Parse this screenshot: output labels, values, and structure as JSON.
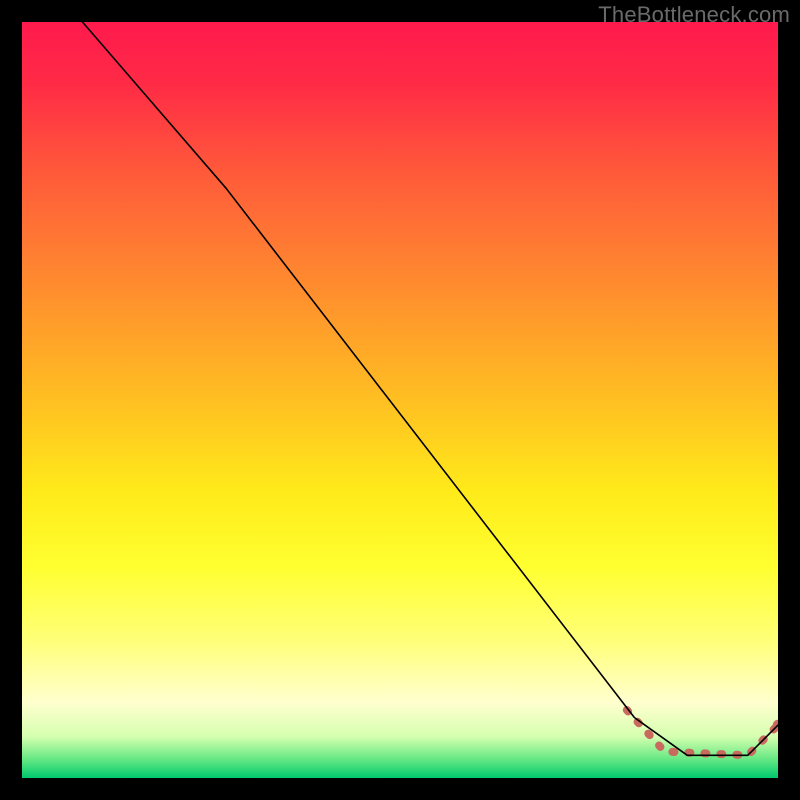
{
  "watermark": "TheBottleneck.com",
  "colors": {
    "background": "#000000",
    "line_solid": "#000000",
    "line_dashed": "#c96a5e",
    "watermark_text": "#6a6a6a",
    "gradient_stops": [
      {
        "offset": 0.0,
        "color": "#ff1a4d"
      },
      {
        "offset": 0.08,
        "color": "#ff2a46"
      },
      {
        "offset": 0.2,
        "color": "#ff5a3a"
      },
      {
        "offset": 0.35,
        "color": "#ff8c2e"
      },
      {
        "offset": 0.5,
        "color": "#ffbf22"
      },
      {
        "offset": 0.62,
        "color": "#ffea1a"
      },
      {
        "offset": 0.72,
        "color": "#ffff30"
      },
      {
        "offset": 0.82,
        "color": "#ffff7a"
      },
      {
        "offset": 0.9,
        "color": "#ffffcf"
      },
      {
        "offset": 0.945,
        "color": "#d6ffb0"
      },
      {
        "offset": 0.975,
        "color": "#66e884"
      },
      {
        "offset": 1.0,
        "color": "#00c96e"
      }
    ]
  },
  "chart_data": {
    "type": "line",
    "title": "",
    "xlabel": "",
    "ylabel": "",
    "xlim": [
      0,
      100
    ],
    "ylim": [
      0,
      100
    ],
    "series": [
      {
        "name": "main-curve",
        "style": "solid",
        "points": [
          {
            "x": 8,
            "y": 100
          },
          {
            "x": 27,
            "y": 78
          },
          {
            "x": 81,
            "y": 8
          },
          {
            "x": 88,
            "y": 3
          },
          {
            "x": 96,
            "y": 3
          },
          {
            "x": 100,
            "y": 7
          }
        ]
      },
      {
        "name": "highlight-segment",
        "style": "dashed",
        "points": [
          {
            "x": 80,
            "y": 9
          },
          {
            "x": 85,
            "y": 3.5
          },
          {
            "x": 96,
            "y": 3
          },
          {
            "x": 100,
            "y": 7
          }
        ]
      }
    ]
  }
}
